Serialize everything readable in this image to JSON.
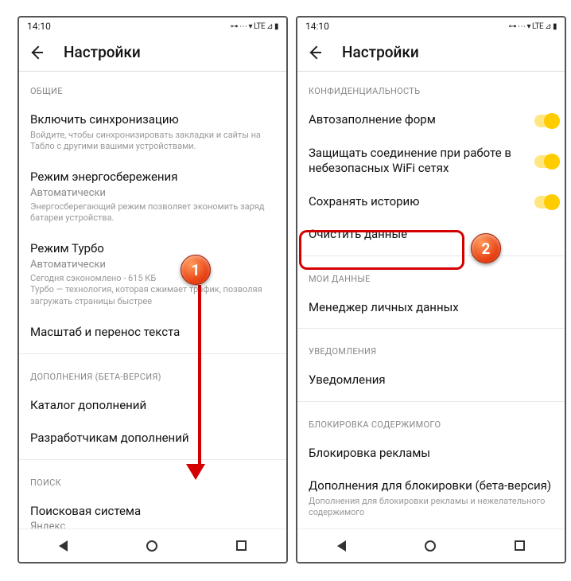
{
  "status": {
    "time": "14:10",
    "indicators": "⊶ ⋯ ▾ LTE ⊿ ▮"
  },
  "appbar": {
    "title": "Настройки"
  },
  "left": {
    "sections": {
      "general": "ОБЩИЕ",
      "addons": "ДОПОЛНЕНИЯ (БЕТА-ВЕРСИЯ)",
      "search": "ПОИСК"
    },
    "sync": {
      "label": "Включить синхронизацию",
      "desc": "Войдите, чтобы синхронизировать закладки и сайты на Табло с другими вашими устройствами."
    },
    "power": {
      "label": "Режим энергосбережения",
      "sublabel": "Автоматически",
      "desc": "Энергосберегающий режим позволяет экономить заряд батареи устройства."
    },
    "turbo": {
      "label": "Режим Турбо",
      "sublabel": "Автоматически",
      "desc": "Сегодня сэкономлено - 615 КБ\nТурбо — технология, которая сжимает трафик, позволяя загружать страницы быстрее"
    },
    "zoom": {
      "label": "Масштаб и перенос текста"
    },
    "catalog": {
      "label": "Каталог дополнений"
    },
    "devaddons": {
      "label": "Разработчикам дополнений"
    },
    "searchengine": {
      "label": "Поисковая система",
      "sublabel": "Яндекс"
    }
  },
  "right": {
    "sections": {
      "privacy": "КОНФИДЕНЦИАЛЬНОСТЬ",
      "mydata": "МОИ ДАННЫЕ",
      "notifications": "УВЕДОМЛЕНИЯ",
      "blocking": "БЛОКИРОВКА СОДЕРЖИМОГО"
    },
    "autofill": {
      "label": "Автозаполнение форм"
    },
    "protect": {
      "label": "Защищать соединение при работе в небезопасных WiFi сетях"
    },
    "history": {
      "label": "Сохранять историю"
    },
    "clear": {
      "label": "Очистить данные"
    },
    "manager": {
      "label": "Менеджер личных данных"
    },
    "notif": {
      "label": "Уведомления"
    },
    "adblock": {
      "label": "Блокировка рекламы"
    },
    "blockaddons": {
      "label": "Дополнения для блокировки (бета-версия)",
      "desc": "Дополнения для блокировки рекламы и нежелательного содержимого"
    }
  },
  "callouts": {
    "one": "1",
    "two": "2"
  }
}
